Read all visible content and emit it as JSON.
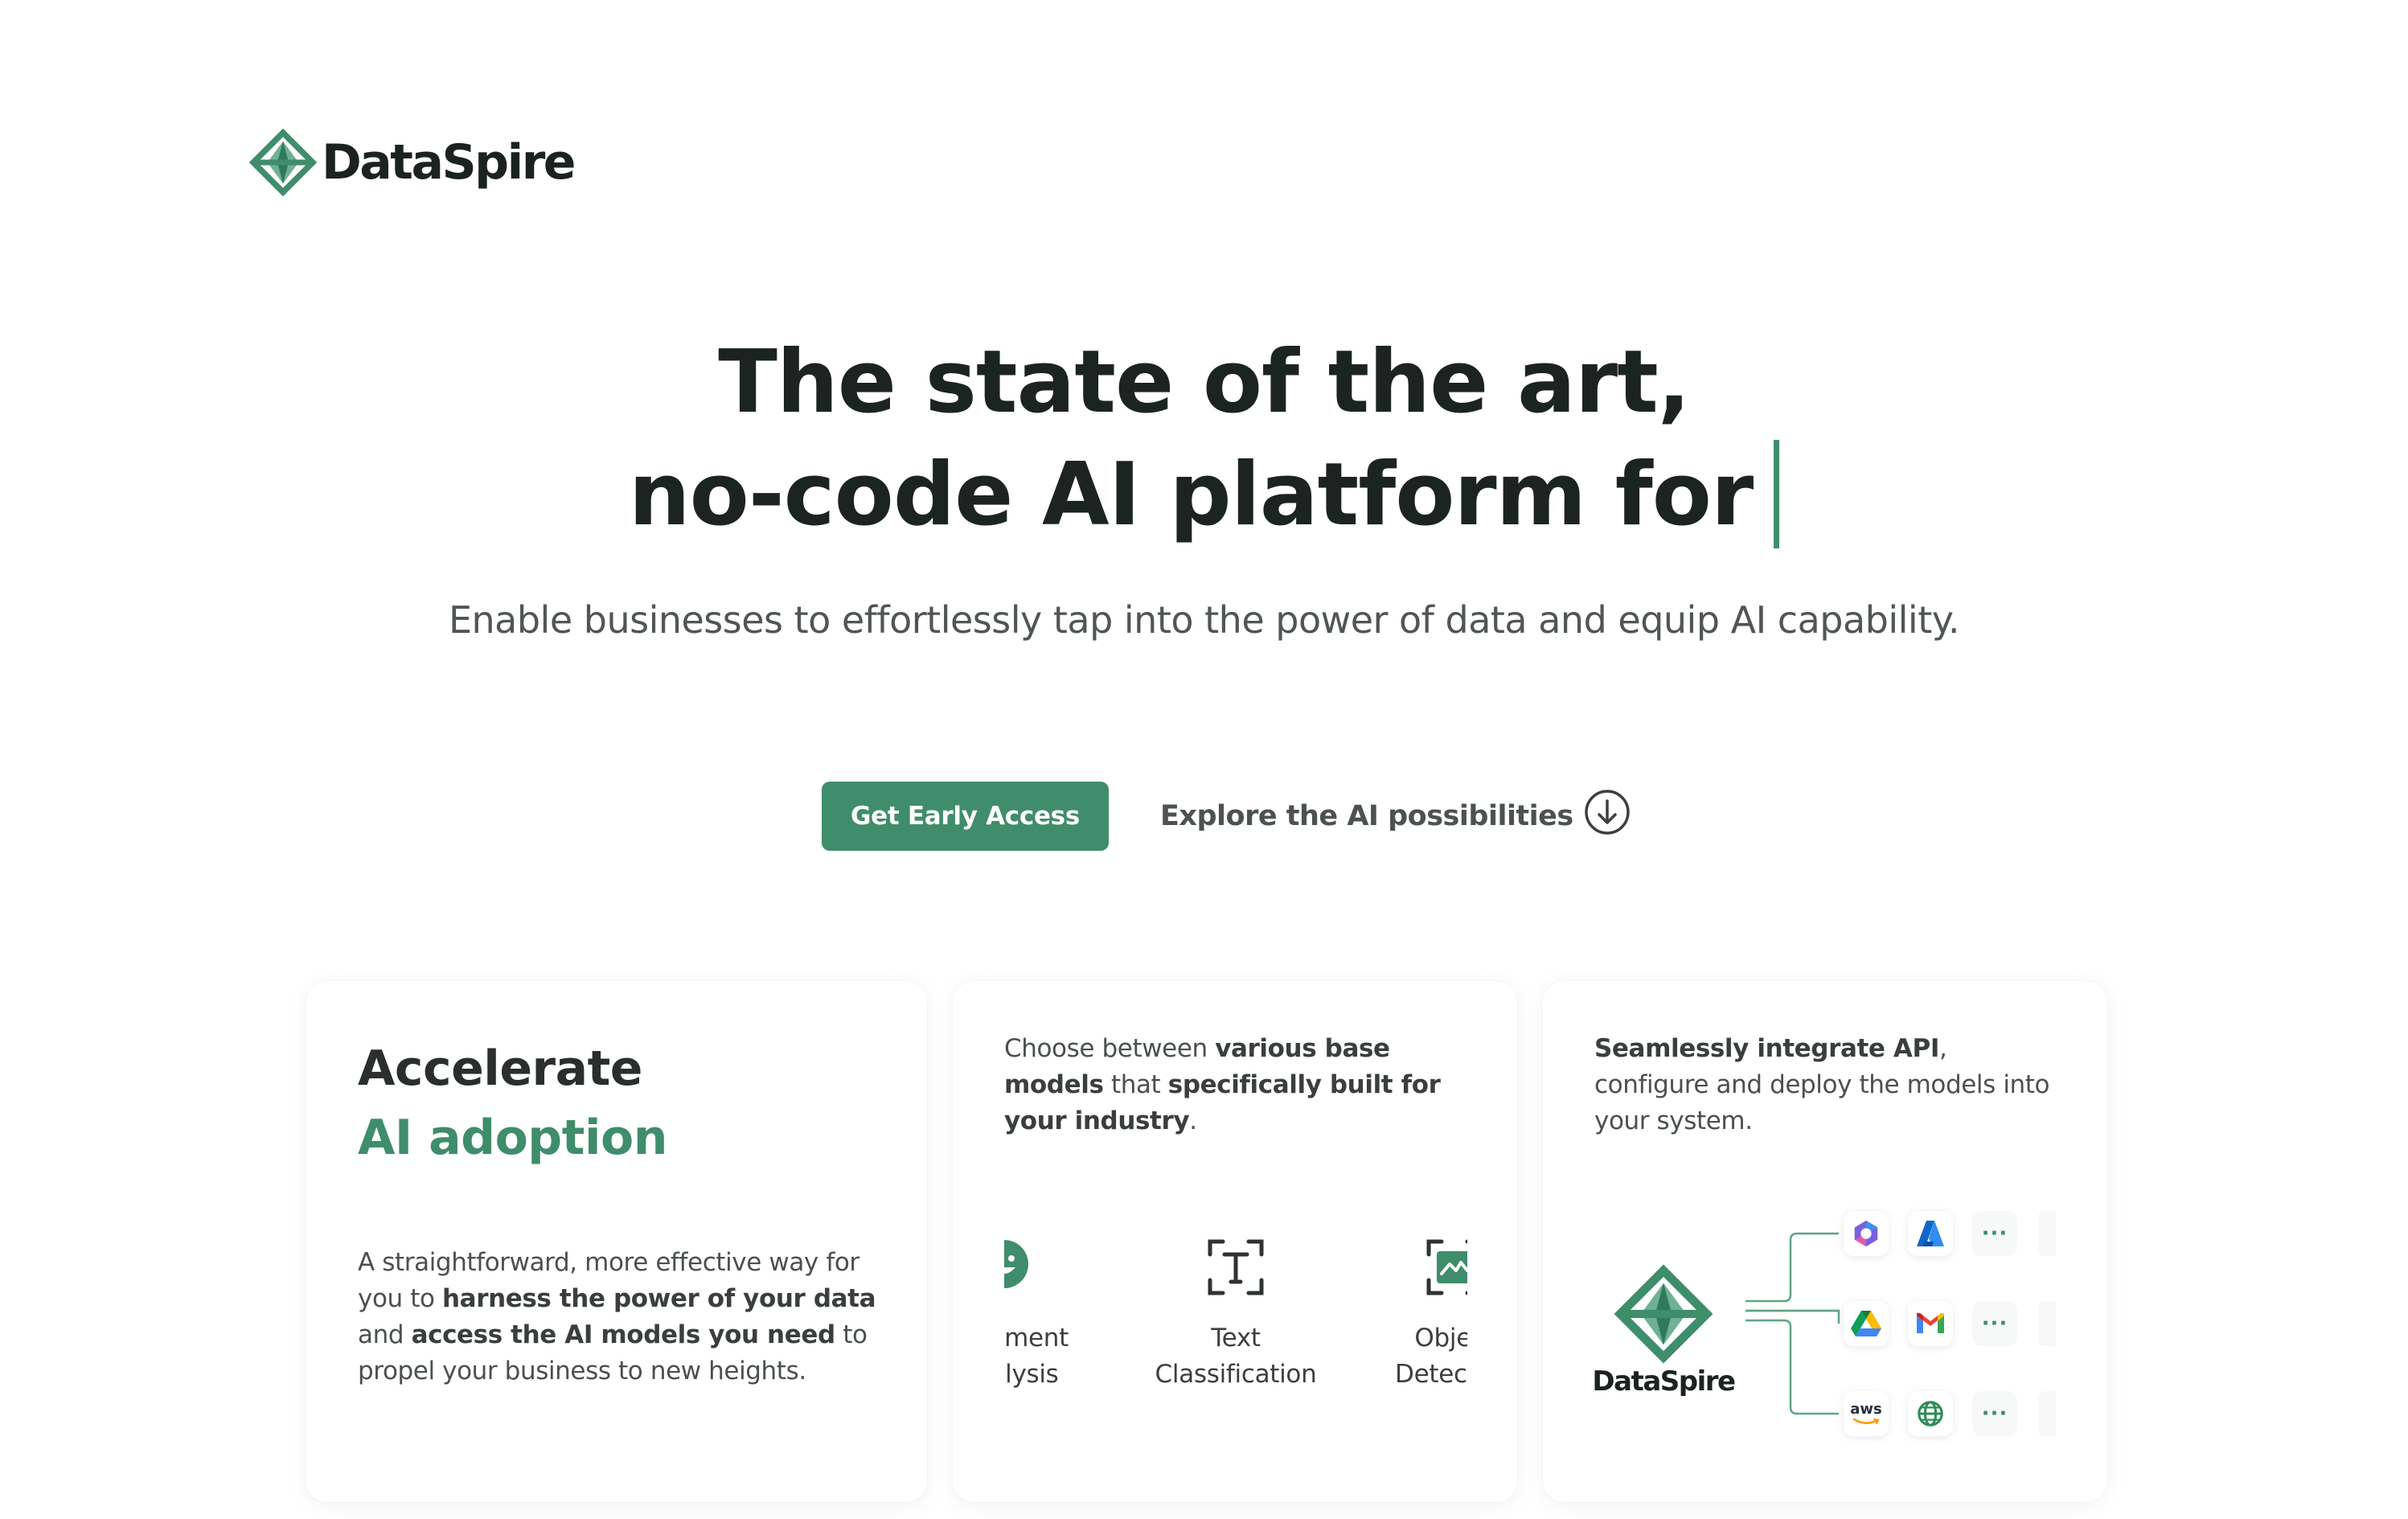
{
  "brand": {
    "name": "DataSpire",
    "color": "#3f8d6b"
  },
  "hero": {
    "title_line1": "The state of the art,",
    "title_line2": "no-code AI platform for",
    "subtitle": "Enable businesses to effortlessly tap into the power of data and equip AI capability."
  },
  "actions": {
    "primary_label": "Get Early Access",
    "secondary_label": "Explore the AI possibilities",
    "secondary_icon": "arrow-down-circle-icon"
  },
  "cards": {
    "adoption": {
      "title_dark": "Accelerate",
      "title_green": "AI adoption",
      "body": [
        {
          "text": "A straightforward, more effective way for you to ",
          "bold": false
        },
        {
          "text": "harness the power of your data",
          "bold": true
        },
        {
          "text": " and ",
          "bold": false
        },
        {
          "text": "access the AI models you need",
          "bold": true
        },
        {
          "text": " to propel your business to new heights.",
          "bold": false
        }
      ]
    },
    "models": {
      "body": [
        {
          "text": "Choose between ",
          "bold": false
        },
        {
          "text": "various base models",
          "bold": true
        },
        {
          "text": " that ",
          "bold": false
        },
        {
          "text": "specifically built for your industry",
          "bold": true
        },
        {
          "text": ".",
          "bold": false
        }
      ],
      "items": [
        {
          "label_line1": "timent",
          "label_line2": "alysis",
          "icon": "smiley-face-icon"
        },
        {
          "label_line1": "Text",
          "label_line2": "Classification",
          "icon": "text-scan-icon"
        },
        {
          "label_line1": "Object",
          "label_line2": "Detection",
          "icon": "image-scan-icon"
        }
      ]
    },
    "integration": {
      "body": [
        {
          "text": "Seamlessly integrate API",
          "bold": true
        },
        {
          "text": ", configure and deploy the models into your system.",
          "bold": false
        }
      ],
      "logo_word": "DataSpire",
      "row1": [
        "microsoft-copilot-icon",
        "azure-icon",
        "more"
      ],
      "row2": [
        "google-drive-icon",
        "gmail-icon",
        "more"
      ],
      "row3": [
        "aws-icon",
        "globe-icon",
        "more"
      ],
      "more_label": "···",
      "aws_label": "aws"
    }
  }
}
